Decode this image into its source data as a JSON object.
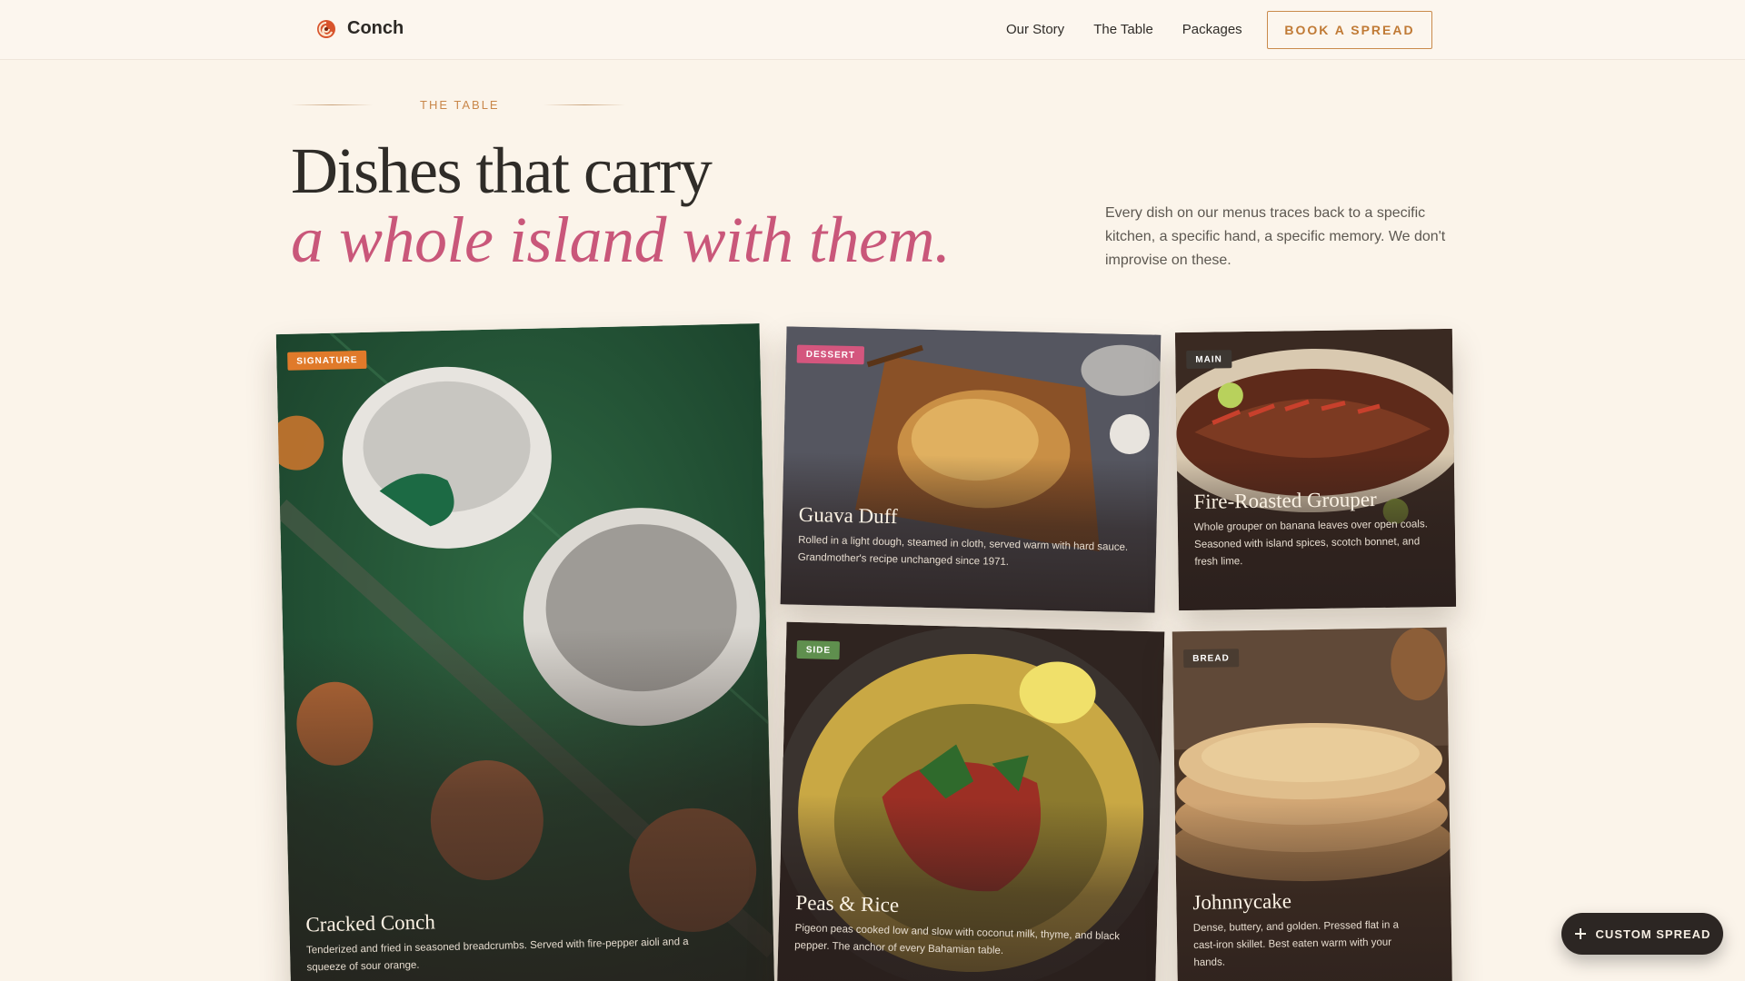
{
  "nav": {
    "brand": "Conch",
    "links": [
      "Our Story",
      "The Table",
      "Packages"
    ],
    "cta": "BOOK A SPREAD"
  },
  "hero": {
    "eyebrow": "THE TABLE",
    "title": "Dishes that carry",
    "title_accent": "a whole island with them.",
    "lede": "Every dish on our menus traces back to a specific kitchen, a specific hand, a specific memory. We don't improvise on these."
  },
  "dishes": [
    {
      "badge": "SIGNATURE",
      "badge_color": "#e07a2a",
      "title": "Cracked Conch",
      "desc": "Tenderized and fried in seasoned breadcrumbs. Served with fire-pepper aioli and a squeeze of sour orange."
    },
    {
      "badge": "DESSERT",
      "badge_color": "#d4567e",
      "title": "Guava Duff",
      "desc": "Rolled in a light dough, steamed in cloth, served warm with hard sauce. Grandmother's recipe unchanged since 1971."
    },
    {
      "badge": "MAIN",
      "badge_color": "#3d3732",
      "title": "Fire-Roasted Grouper",
      "desc": "Whole grouper on banana leaves over open coals. Seasoned with island spices, scotch bonnet, and fresh lime."
    },
    {
      "badge": "SIDE",
      "badge_color": "#5f8f4e",
      "title": "Peas & Rice",
      "desc": "Pigeon peas cooked low and slow with coconut milk, thyme, and black pepper. The anchor of every Bahamian table."
    },
    {
      "badge": "BREAD",
      "badge_color": "#4a3c31",
      "title": "Johnnycake",
      "desc": "Dense, buttery, and golden. Pressed flat in a cast-iron skillet. Best eaten warm with your hands."
    }
  ],
  "fab": {
    "label": "CUSTOM SPREAD"
  },
  "colors": {
    "accent": "#c9577a",
    "gold": "#c98a4b",
    "bg": "#fbf4ea"
  }
}
